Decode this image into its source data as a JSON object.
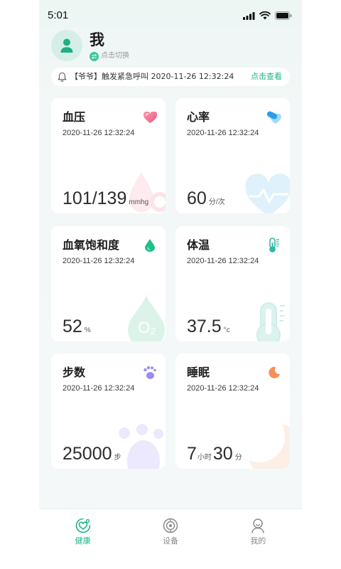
{
  "status_bar": {
    "time": "5:01",
    "icons": [
      "signal-icon",
      "wifi-icon",
      "battery-icon"
    ]
  },
  "header": {
    "name": "我",
    "avatar_icon": "person-icon",
    "switch_icon": "switch-icon",
    "switch_label": "点击切换"
  },
  "alert": {
    "icon": "bell-icon",
    "text": "【爷爷】触发紧急呼叫 2020-11-26 12:32:24",
    "action": "点击查看"
  },
  "cards": [
    {
      "title": "血压",
      "date": "2020-11-26 12:32:24",
      "value": "101/139",
      "unit": "mmhg",
      "icon": "heart-icon",
      "color": "#f4678a"
    },
    {
      "title": "心率",
      "date": "2020-11-26 12:32:24",
      "value": "60",
      "unit": "分/次",
      "icon": "heart-rate-icon",
      "color": "#2ea6ea"
    },
    {
      "title": "血氧饱和度",
      "date": "2020-11-26 12:32:24",
      "value": "52",
      "unit": "%",
      "icon": "drop-icon",
      "color": "#1fbf8c",
      "decor_text": "O₂"
    },
    {
      "title": "体温",
      "date": "2020-11-26 12:32:24",
      "value": "37.5",
      "unit": "°c",
      "icon": "thermometer-icon",
      "color": "#2fb6a4"
    },
    {
      "title": "步数",
      "date": "2020-11-26 12:32:24",
      "value": "25000",
      "unit": "步",
      "icon": "footprint-icon",
      "color": "#9a8cf0"
    },
    {
      "title": "睡眠",
      "date": "2020-11-26 12:32:24",
      "value": "7",
      "unit": "小时",
      "value2": "30",
      "unit2": "分",
      "icon": "moon-icon",
      "color": "#f5905a"
    }
  ],
  "tabs": [
    {
      "label": "健康",
      "icon": "health-icon",
      "active": true
    },
    {
      "label": "设备",
      "icon": "device-icon",
      "active": false
    },
    {
      "label": "我的",
      "icon": "profile-icon",
      "active": false
    }
  ],
  "colors": {
    "accent": "#1fb38a",
    "background": "#f3f7f7",
    "card": "#ffffff",
    "inactive": "#8a8a8a"
  }
}
